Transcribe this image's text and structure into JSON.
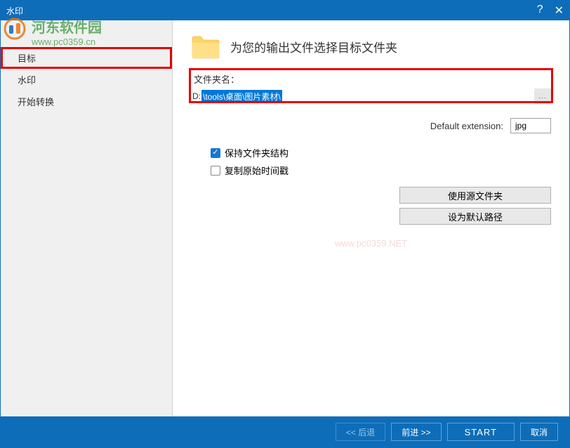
{
  "titlebar": {
    "title": "水印"
  },
  "watermark": {
    "text": "河东软件园",
    "url": "www.pc0359.cn"
  },
  "sidebar": {
    "items": [
      {
        "label": "目标",
        "selected": true
      },
      {
        "label": "水印",
        "selected": false
      },
      {
        "label": "开始转换",
        "selected": false
      }
    ]
  },
  "main": {
    "title": "为您的输出文件选择目标文件夹",
    "folder_label": "文件夹名：",
    "path_prefix": "D:",
    "path_selected": "\\tools\\桌面\\图片素材\\",
    "ext_label": "Default extension:",
    "ext_value": "jpg",
    "checkboxes": [
      {
        "label": "保持文件夹结构",
        "checked": true
      },
      {
        "label": "复制原始时间戳",
        "checked": false
      }
    ],
    "source_btn": "使用源文件夹",
    "default_btn": "设为默认路径",
    "faint_text": "www.pc0359.NET"
  },
  "footer": {
    "back": "<< 后退",
    "forward": "前进 >>",
    "start": "START",
    "cancel": "取消"
  }
}
